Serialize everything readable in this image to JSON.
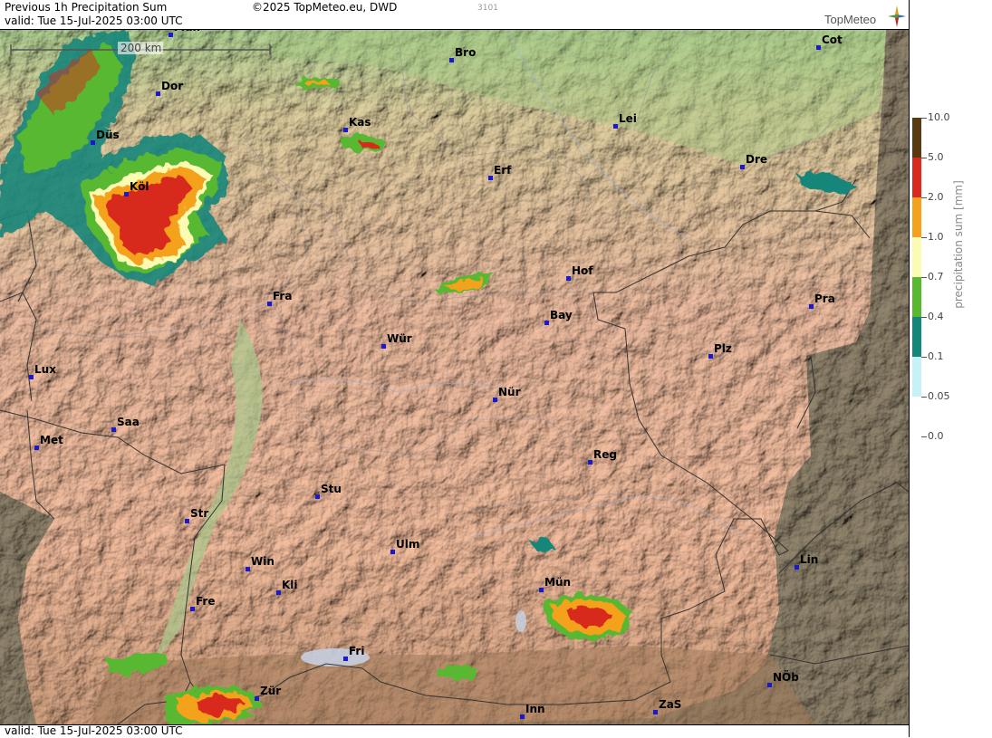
{
  "header": {
    "title": "Previous 1h Precipitation Sum",
    "valid": "valid:  Tue  15-Jul-2025 03:00 UTC",
    "copyright": "©2025 TopMeteo.eu, DWD",
    "code": "3101",
    "logo": "TopMeteo"
  },
  "footer": {
    "valid": "valid:  Tue  15-Jul-2025 03:00 UTC"
  },
  "scale_bar": {
    "label": "200 km"
  },
  "legend": {
    "title": "precipitation sum [mm]",
    "levels": [
      {
        "label": "10.0",
        "color": "#5a3a10"
      },
      {
        "label": "5.0",
        "color": "#d82a1e"
      },
      {
        "label": "2.0",
        "color": "#f4a21e"
      },
      {
        "label": "1.0",
        "color": "#fbfbb4"
      },
      {
        "label": "0.7",
        "color": "#58b830"
      },
      {
        "label": "0.4",
        "color": "#14867a"
      },
      {
        "label": "0.1",
        "color": "#c6f2f7"
      },
      {
        "label": "0.05",
        "color": ""
      },
      {
        "label": "0.0",
        "color": ""
      }
    ]
  },
  "cities": [
    "Mün",
    "Bro",
    "Cot",
    "Dor",
    "Kas",
    "Lei",
    "Düs",
    "Dre",
    "Erf",
    "Köl",
    "Hof",
    "Fra",
    "Pra",
    "Bay",
    "Wür",
    "Plz",
    "Lux",
    "Nür",
    "Saa",
    "Met",
    "Reg",
    "Stu",
    "Str",
    "Ulm",
    "Lin",
    "Win",
    "Kli",
    "Mün",
    "Fre",
    "Fri",
    "NÖb",
    "Zür",
    "Inn",
    "ZaS"
  ]
}
